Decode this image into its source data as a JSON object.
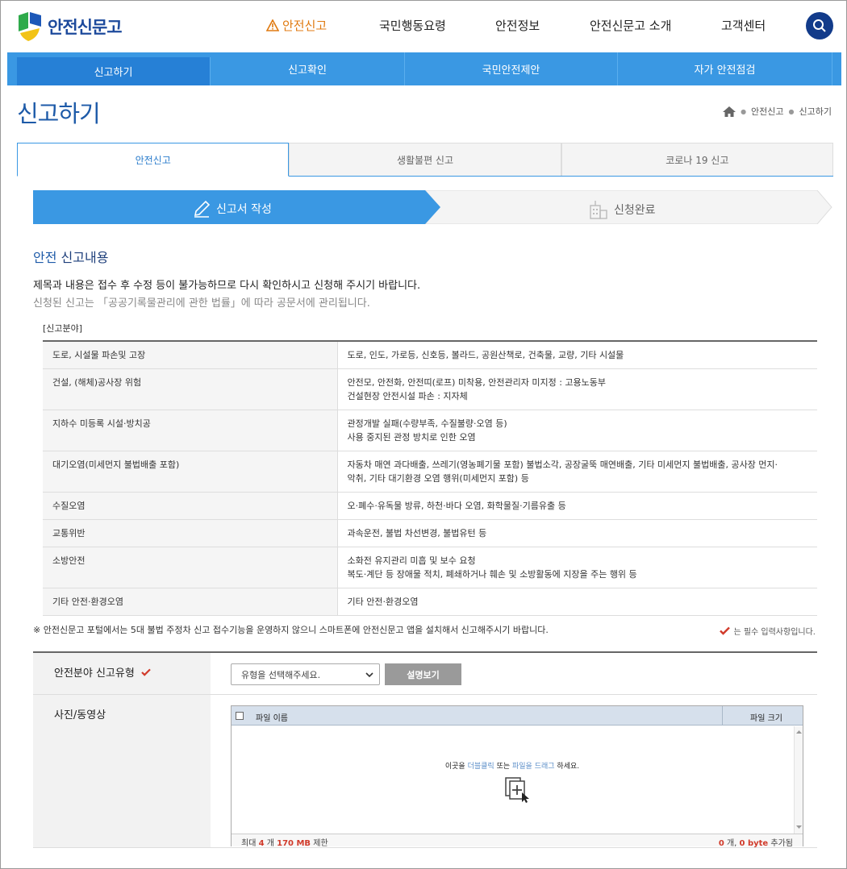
{
  "header": {
    "logo_text": "안전신문고",
    "nav": [
      {
        "label": "안전신고"
      },
      {
        "label": "국민행동요령"
      },
      {
        "label": "안전정보"
      },
      {
        "label": "안전신문고 소개"
      },
      {
        "label": "고객센터"
      }
    ]
  },
  "subnav": [
    "신고하기",
    "신고확인",
    "국민안전제안",
    "자가 안전점검"
  ],
  "page_title": "신고하기",
  "breadcrumb": [
    "안전신고",
    "신고하기"
  ],
  "tabs": [
    "안전신고",
    "생활불편 신고",
    "코로나 19 신고"
  ],
  "steps": [
    "신고서 작성",
    "신청완료"
  ],
  "section": {
    "title_blue": "안전",
    "title_rest": " 신고내용",
    "notice1": "제목과 내용은 접수 후 수정 등이 불가능하므로 다시 확인하시고 신청해 주시기 바랍니다.",
    "notice2": "신청된 신고는 「공공기록물관리에 관한 법률」에 따라 공문서에 관리됩니다."
  },
  "category_caption": "[신고분야]",
  "categories": [
    {
      "name": "도로, 시설물 파손및 고장",
      "desc1": "도로, 인도, 가로등, 신호등, 볼라드, 공원산책로, 건축물, 교량, 기타 시설물",
      "desc2": ""
    },
    {
      "name": "건설, (해체)공사장 위험",
      "desc1": "안전모, 안전화, 안전띠(로프) 미착용, 안전관리자 미지정 : 고용노동부",
      "desc2": "건설현장 안전시설 파손 : 지자체"
    },
    {
      "name": "지하수 미등록 시설·방치공",
      "desc1": "관정개발 실패(수량부족, 수질불량·오염 등)",
      "desc2": "사용 중지된 관정 방치로 인한 오염"
    },
    {
      "name": "대기오염(미세먼지 불법배출 포함)",
      "desc1": "자동차 매연 과다배출, 쓰레기(영농폐기물 포함) 불법소각, 공장굴뚝 매연배출, 기타 미세먼지 불법배출, 공사장 먼지·",
      "desc2": "악취, 기타 대기환경 오염 행위(미세먼지 포함) 등"
    },
    {
      "name": "수질오염",
      "desc1": "오·폐수·유독물 방류, 하천·바다 오염, 화학물질·기름유출 등",
      "desc2": ""
    },
    {
      "name": "교통위반",
      "desc1": "과속운전, 불법 차선변경, 불법유턴 등",
      "desc2": ""
    },
    {
      "name": "소방안전",
      "desc1": "소화전 유지관리 미흡 및 보수 요청",
      "desc2": "복도·계단 등 장애물 적치, 폐쇄하거나 훼손 및 소방활동에 지장을 주는 행위 등"
    },
    {
      "name": "기타 안전·환경오염",
      "desc1": "기타 안전·환경오염",
      "desc2": ""
    }
  ],
  "footnote": "※ 안전신문고 포털에서는 5대 불법 주정차 신고 접수기능을 운영하지 않으니 스마트폰에 안전신문고 앱을 설치해서 신고해주시기 바랍니다.",
  "required_note": "는 필수 입력사항입니다.",
  "form": {
    "type_label": "안전분야 신고유형",
    "type_select": "유형을 선택해주세요.",
    "desc_button": "설명보기",
    "media_label": "사진/동영상",
    "uploader": {
      "col_name": "파일 이름",
      "col_size": "파일 크기",
      "msg_pre": "이곳을 ",
      "msg_dbl": "더블클릭",
      "msg_mid": " 또는 ",
      "msg_drag": "파일을 드래그",
      "msg_post": " 하세요.",
      "foot_pre": "최대 ",
      "foot_count": "4",
      "foot_mid": " 개 ",
      "foot_mb": "170 MB",
      "foot_post": " 제한",
      "right_count": "0",
      "right_mid": " 개, ",
      "right_bytes": "0 byte",
      "right_post": " 추가됨"
    }
  },
  "colors": {
    "brand_blue": "#1d5aa8",
    "subnav": "#3a98e3",
    "accent_orange": "#e07a10",
    "required_red": "#d13a2a"
  }
}
